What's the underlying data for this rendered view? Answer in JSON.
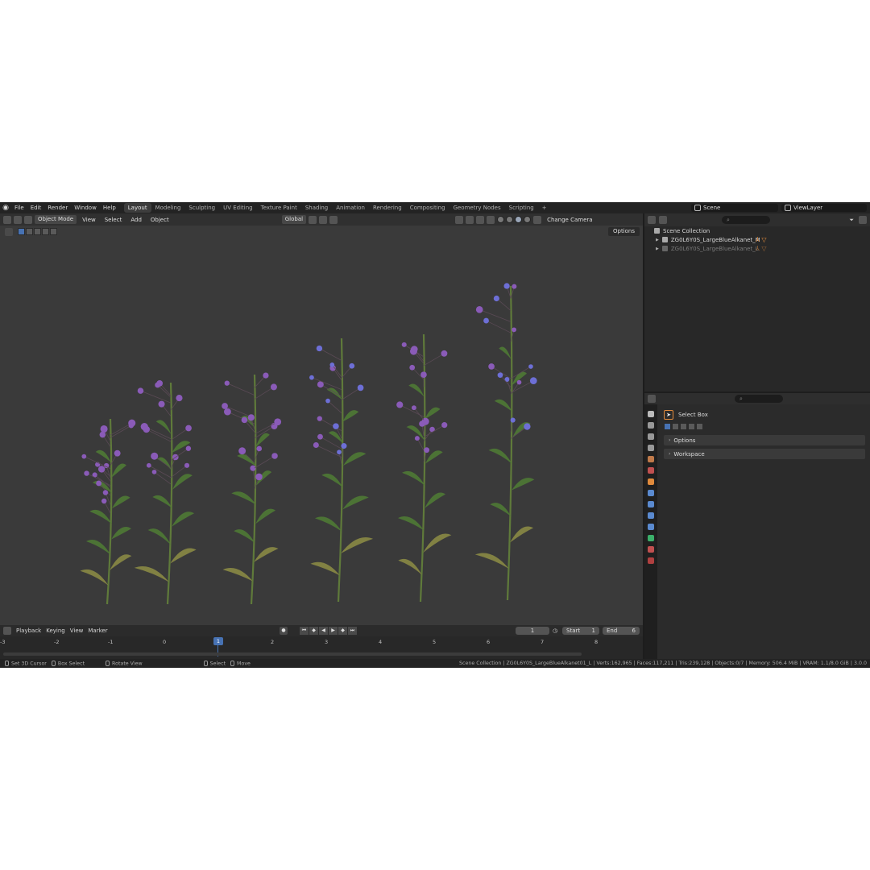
{
  "menu": [
    "File",
    "Edit",
    "Render",
    "Window",
    "Help"
  ],
  "workspaces": [
    {
      "label": "Layout",
      "active": true
    },
    {
      "label": "Modeling",
      "active": false
    },
    {
      "label": "Sculpting",
      "active": false
    },
    {
      "label": "UV Editing",
      "active": false
    },
    {
      "label": "Texture Paint",
      "active": false
    },
    {
      "label": "Shading",
      "active": false
    },
    {
      "label": "Animation",
      "active": false
    },
    {
      "label": "Rendering",
      "active": false
    },
    {
      "label": "Compositing",
      "active": false
    },
    {
      "label": "Geometry Nodes",
      "active": false
    },
    {
      "label": "Scripting",
      "active": false
    }
  ],
  "add_workspace": "+",
  "scene": {
    "name": "Scene",
    "view_layer": "ViewLayer"
  },
  "viewport": {
    "mode": "Object Mode",
    "menus": [
      "View",
      "Select",
      "Add",
      "Object"
    ],
    "orientation": "Global",
    "change_camera": "Change Camera",
    "options": "Options"
  },
  "timeline": {
    "menus": [
      "Playback",
      "Keying",
      "View",
      "Marker"
    ],
    "current_frame": "1",
    "start_label": "Start",
    "start_value": "1",
    "end_label": "End",
    "end_value": "6",
    "ruler": [
      "-3",
      "-2",
      "-1",
      "0",
      "1",
      "2",
      "3",
      "4",
      "5",
      "6",
      "7",
      "8"
    ],
    "playhead": "1"
  },
  "outliner": {
    "root": "Scene Collection",
    "items": [
      {
        "label": "ZG0L6Y0S_LargeBlueAlkanet_M",
        "dim": false
      },
      {
        "label": "ZG0L6Y0S_LargeBlueAlkanet_L",
        "dim": true
      }
    ]
  },
  "properties": {
    "tool": "Select Box",
    "panels": [
      "Options",
      "Workspace"
    ]
  },
  "status": {
    "hints": [
      "Set 3D Cursor",
      "Box Select",
      "Rotate View",
      "Select",
      "Move"
    ],
    "info": "Scene Collection | ZG0L6Y0S_LargeBlueAlkanet01_L | Verts:162,965 | Faces:117,211 | Tris:239,128 | Objects:0/7 | Memory: 506.4 MiB | VRAM: 1.1/8.0 GiB | 3.0.0"
  },
  "colors": {
    "accent": "#4772b3",
    "flower_blue": "#6d6fd6",
    "flower_purple": "#8a5bb8",
    "leaf_green": "#4f7a35",
    "viewport_bg": "#3a3a3a"
  }
}
